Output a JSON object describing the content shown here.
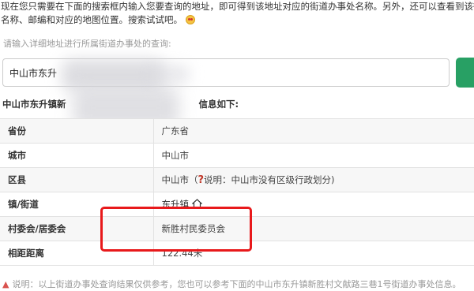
{
  "intro": {
    "line1": "现在您只需要在下面的搜索框内输入您要查询的地址，即可得到该地址对应的街道办事处名称。另外，还可以查看到该街",
    "line2": "名称、邮编和对应的地图位置。搜索试试吧。"
  },
  "search": {
    "hint": "请输入详细地址进行所属街道办事处的查询:",
    "value": "中山市东升"
  },
  "result": {
    "title_a": "中山市东升镇新",
    "title_b": "信息如下:"
  },
  "table": {
    "province_label": "省份",
    "province_value": "广东省",
    "city_label": "城市",
    "city_value": "中山市",
    "county_label": "区县",
    "county_value": "中山市（",
    "county_note": "说明：中山市没有区级行政划分)",
    "town_label": "镇/街道",
    "town_value": "东升镇",
    "committee_label": "村委会/居委会",
    "committee_value": "新胜村民委员会",
    "distance_label": "相距距离",
    "distance_value": "122.44米"
  },
  "note": {
    "text": "说明：以上街道办事处查询结果仅供参考，您也可以参考下面的中山市东升镇新胜村文献路三巷1号街道办事处信息。"
  },
  "colors": {
    "accent": "#28a064",
    "highlight": "#e8191b"
  }
}
